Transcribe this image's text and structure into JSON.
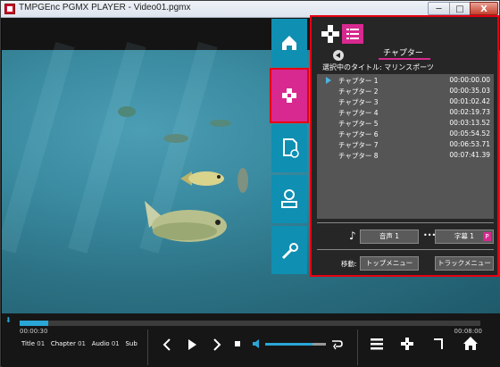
{
  "window": {
    "title": "TMPGEnc PGMX PLAYER - Video01.pgmx",
    "minimize": "─",
    "maximize": "□",
    "close": "X"
  },
  "nav": {
    "home_icon": "home-icon",
    "chapter_icon": "chapter-icon",
    "file_icon": "file-icon",
    "search_icon": "search-icon",
    "settings_icon": "wrench-icon",
    "accent": "#0f8fb2",
    "active_color": "#d7298f"
  },
  "panel": {
    "tab_label": "チャプター",
    "selected_title": "選択中のタイトル: マリンスポーツ",
    "chapters": [
      {
        "name": "チャプター 1",
        "time": "00:00:00.00"
      },
      {
        "name": "チャプター 2",
        "time": "00:00:35.03"
      },
      {
        "name": "チャプター 3",
        "time": "00:01:02.42"
      },
      {
        "name": "チャプター 4",
        "time": "00:02:19.73"
      },
      {
        "name": "チャプター 5",
        "time": "00:03:13.52"
      },
      {
        "name": "チャプター 6",
        "time": "00:05:54.52"
      },
      {
        "name": "チャプター 7",
        "time": "00:06:53.71"
      },
      {
        "name": "チャプター 8",
        "time": "00:07:41.39"
      }
    ],
    "audio_button": "音声 1",
    "subtitle_button": "字幕 1",
    "subtitle_badge": "P",
    "move_label": "移動:",
    "top_menu_button": "トップメニュー",
    "track_menu_button": "トラックメニュー"
  },
  "playback": {
    "current_time": "00:00:30",
    "total_time": "00:08:00",
    "progress": 0.0625,
    "volume": 0.78,
    "title_label": "Title",
    "title_value": "01",
    "chapter_label": "Chapter",
    "chapter_value": "01",
    "audio_label": "Audio",
    "audio_value": "01",
    "sub_label": "Sub"
  }
}
